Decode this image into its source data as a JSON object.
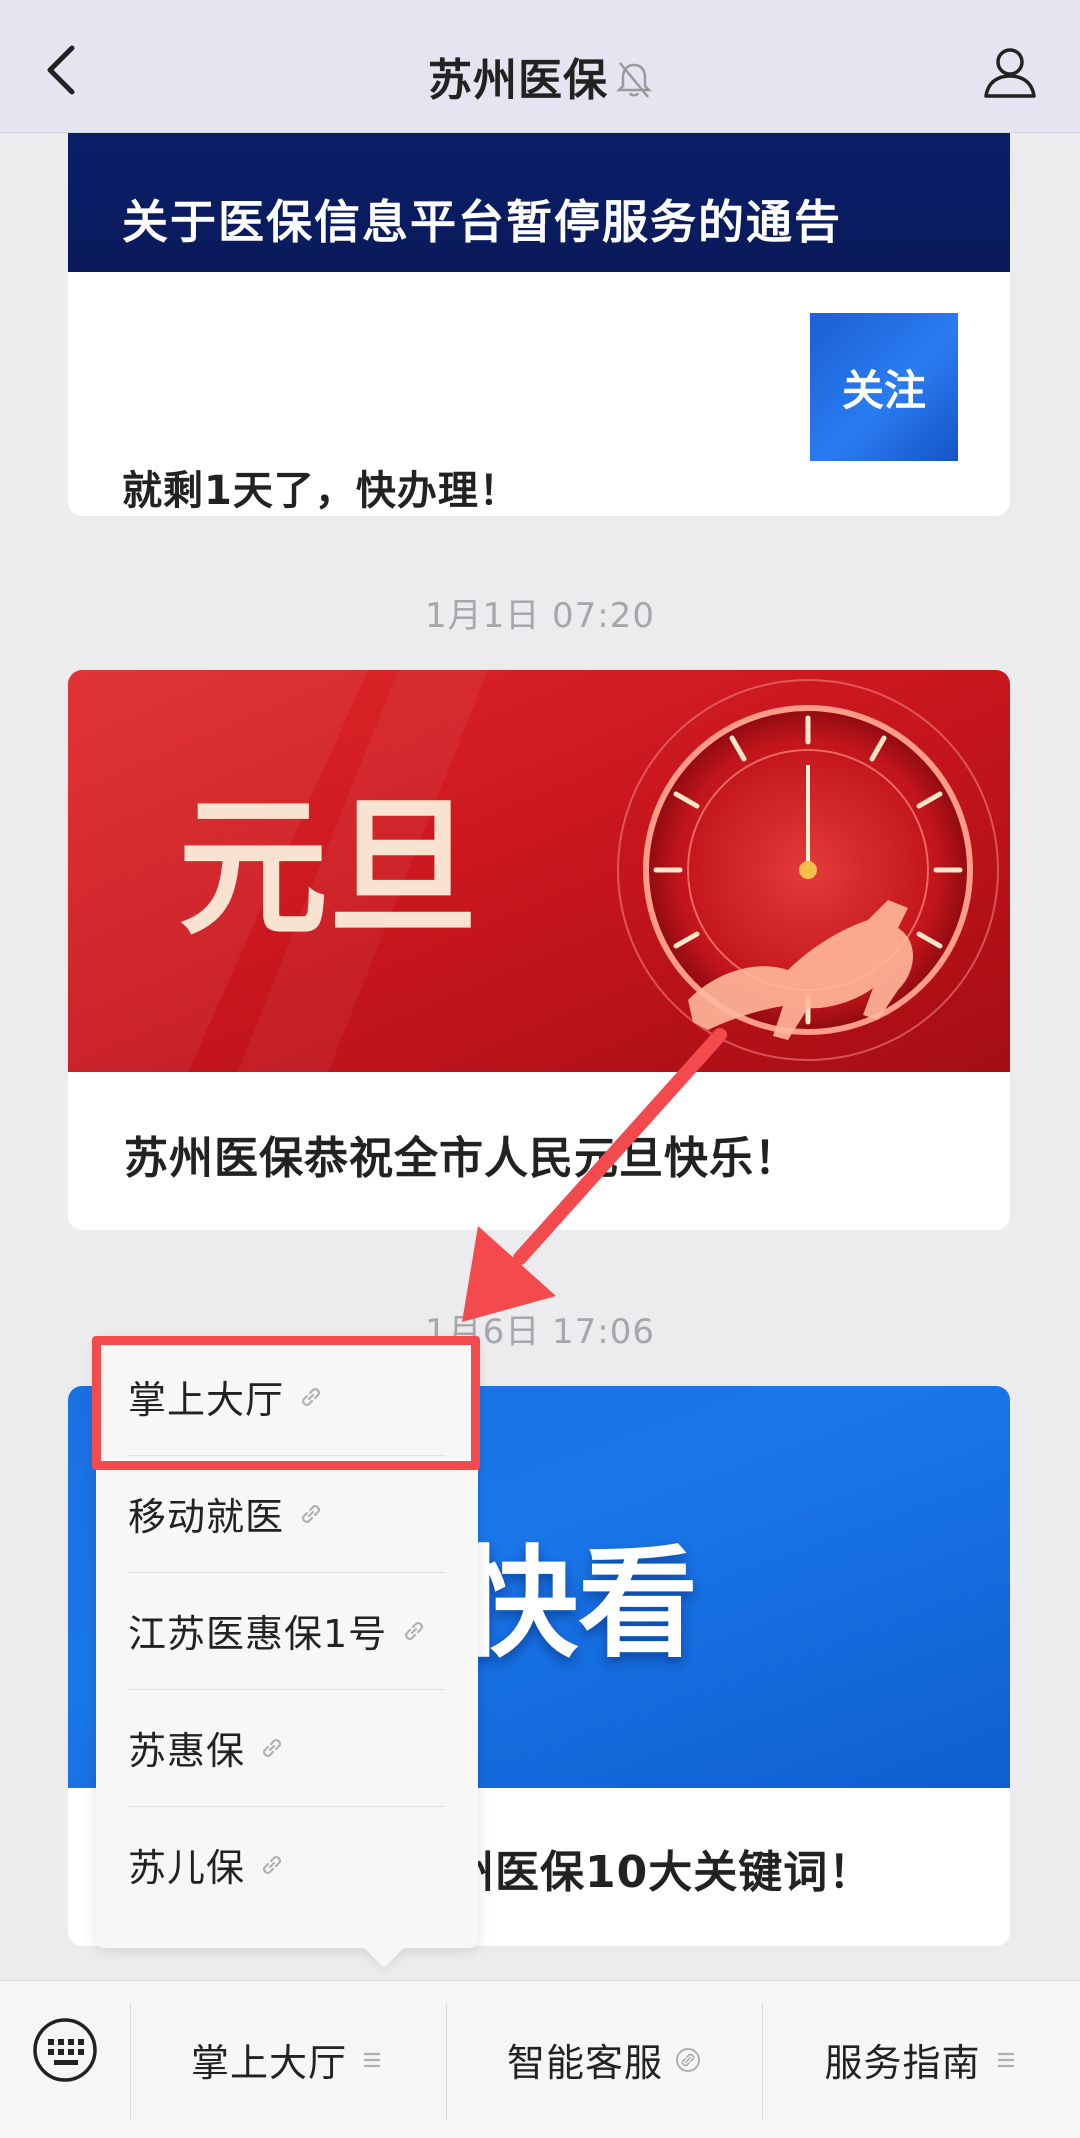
{
  "header": {
    "title": "苏州医保",
    "back_icon": "chevron-left-icon",
    "mute_icon": "bell-off-icon",
    "profile_icon": "user-icon"
  },
  "articles": [
    {
      "banner_title": "关于医保信息平台暂停服务的通告",
      "subtitle": "就剩1天了，快办理！",
      "follow_label": "关注"
    },
    {
      "timestamp": "1月1日 07:20",
      "hero_text": "元旦",
      "caption": "苏州医保恭祝全市人民元旦快乐！"
    },
    {
      "timestamp": "1月6日 17:06",
      "hero_text": "快看",
      "caption": "州医保10大关键词！"
    }
  ],
  "popup_menu": {
    "items": [
      {
        "label": "掌上大厅",
        "icon": "link-icon"
      },
      {
        "label": "移动就医",
        "icon": "link-icon"
      },
      {
        "label": "江苏医惠保1号",
        "icon": "link-icon"
      },
      {
        "label": "苏惠保",
        "icon": "link-icon"
      },
      {
        "label": "苏儿保",
        "icon": "link-icon"
      }
    ]
  },
  "bottom_menu": {
    "keyboard_icon": "keyboard-icon",
    "tabs": [
      {
        "label": "掌上大厅",
        "icon": "menu-icon"
      },
      {
        "label": "智能客服",
        "icon": "link-icon"
      },
      {
        "label": "服务指南",
        "icon": "menu-icon"
      }
    ]
  },
  "colors": {
    "highlight": "#f24a4d",
    "banner_navy": "#0b1f6e",
    "festive_red": "#c8161d",
    "brand_blue": "#1a6fe0"
  }
}
